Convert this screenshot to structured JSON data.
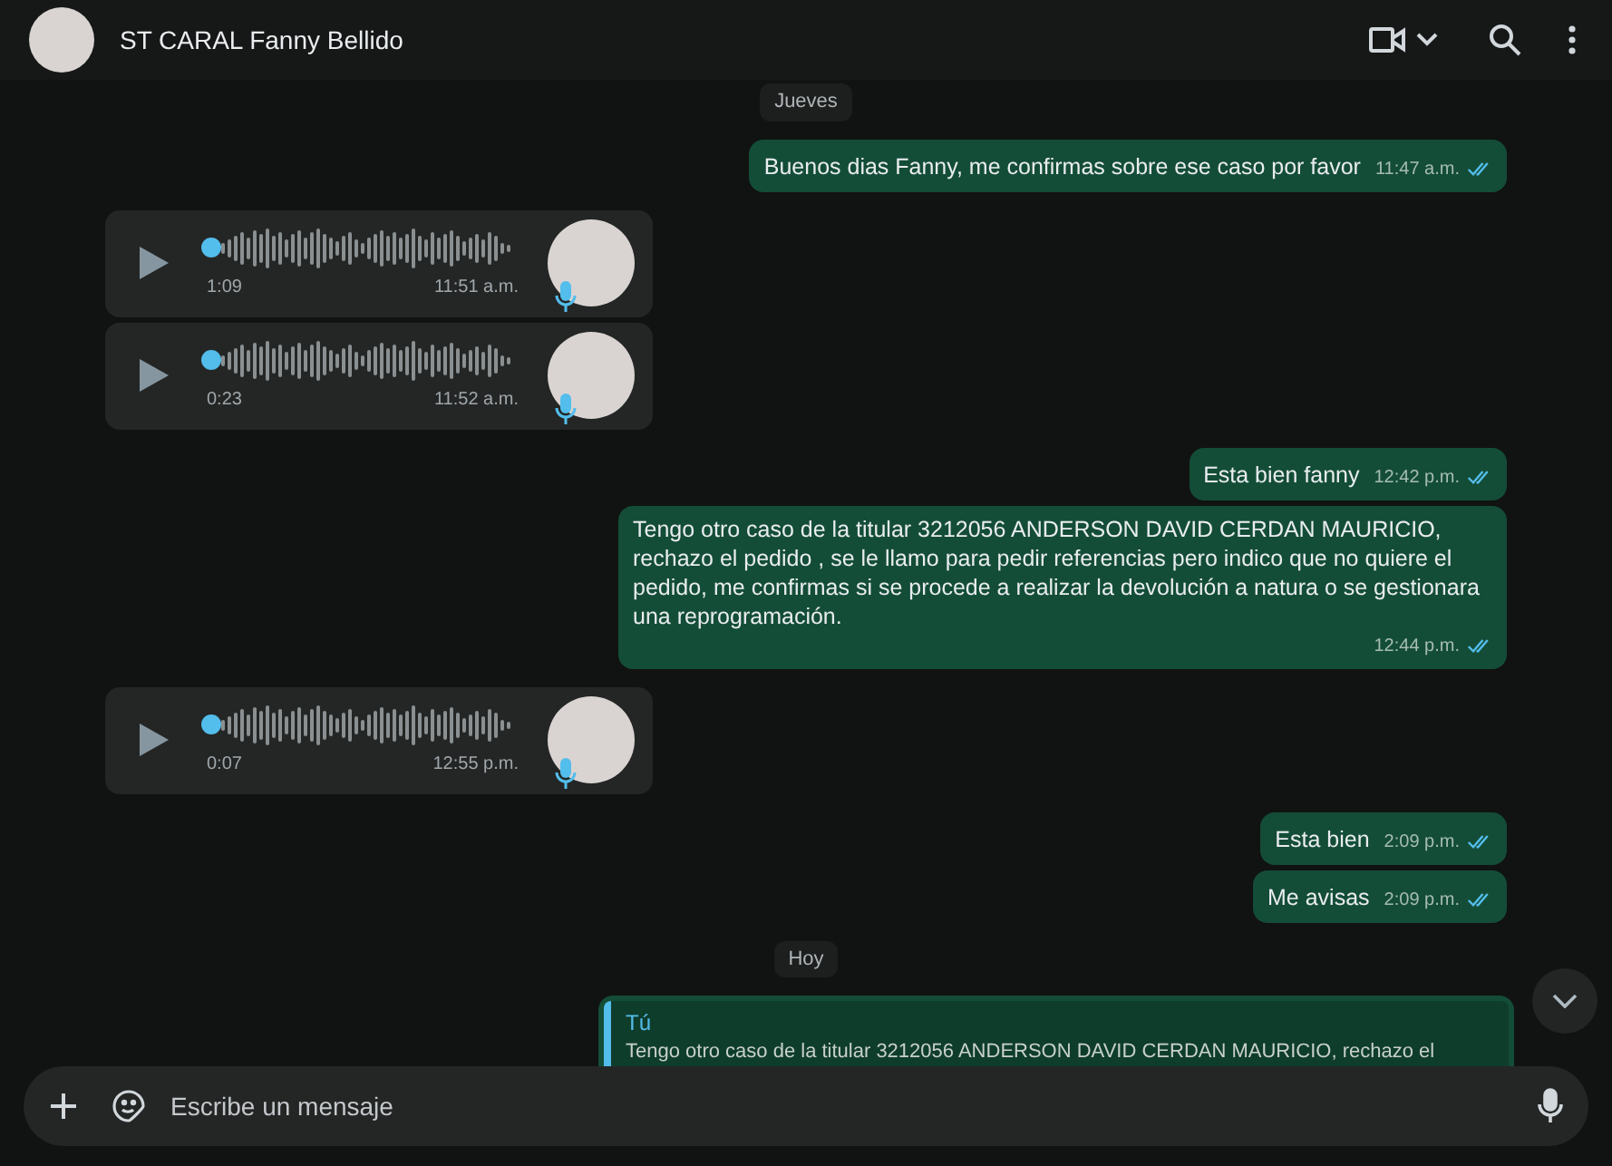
{
  "header": {
    "title": "ST CARAL Fanny Bellido"
  },
  "messages": [
    {
      "kind": "date",
      "text": "Jueves"
    },
    {
      "kind": "out",
      "text": "Buenos dias Fanny, me confirmas sobre ese caso por favor",
      "time": "11:47 a.m.",
      "read": true
    },
    {
      "kind": "voice",
      "duration": "1:09",
      "time": "11:51 a.m.",
      "level": 0
    },
    {
      "kind": "voice",
      "duration": "0:23",
      "time": "11:52 a.m.",
      "level": 0
    },
    {
      "kind": "out",
      "text": "Esta bien fanny",
      "time": "12:42 p.m.",
      "read": true
    },
    {
      "kind": "out",
      "text": "Tengo otro caso de la titular 3212056 ANDERSON DAVID CERDAN MAURICIO, rechazo el pedido , se le llamo para pedir referencias pero indico que no quiere el pedido, me confirmas si se procede a realizar la devolución a natura o se gestionara una reprogramación.",
      "time": "12:44 p.m.",
      "read": true
    },
    {
      "kind": "voice",
      "duration": "0:07",
      "time": "12:55 p.m.",
      "level": 0
    },
    {
      "kind": "out",
      "text": "Esta bien",
      "time": "2:09 p.m.",
      "read": true
    },
    {
      "kind": "out",
      "text": "Me avisas",
      "time": "2:09 p.m.",
      "read": true
    },
    {
      "kind": "date",
      "text": "Hoy"
    },
    {
      "kind": "reply",
      "author": "Tú",
      "text": "Tengo otro caso de la titular 3212056 ANDERSON DAVID CERDAN MAURICIO, rechazo el"
    }
  ],
  "composer": {
    "placeholder": "Escribe un mensaje"
  }
}
